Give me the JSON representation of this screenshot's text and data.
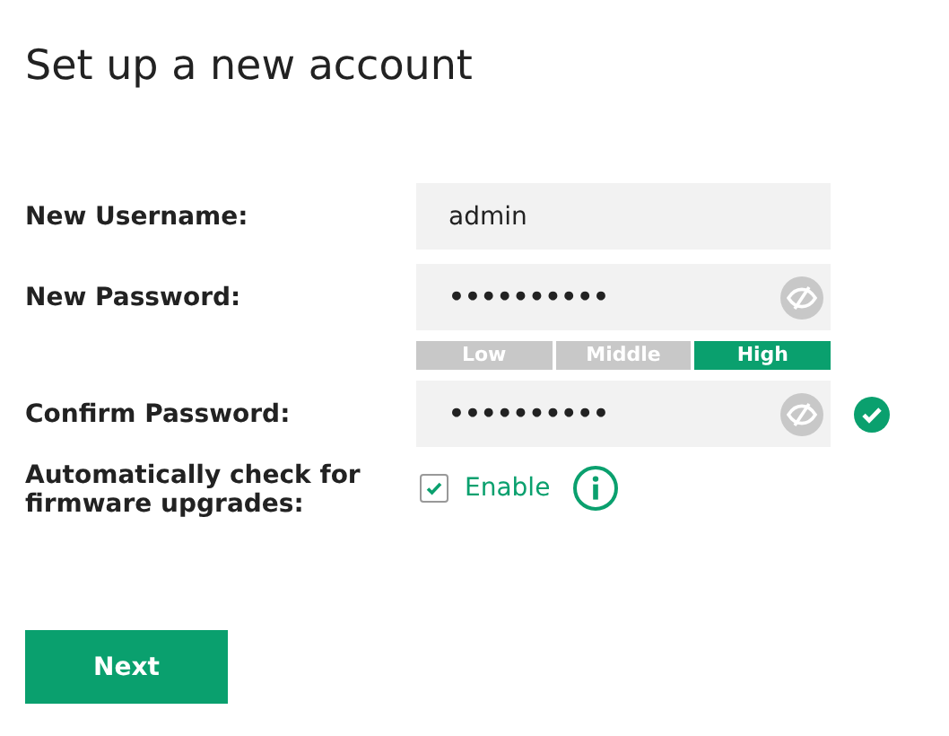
{
  "title": "Set up a new account",
  "fields": [
    {
      "label": "New Username:",
      "value": "admin",
      "kind": "text"
    },
    {
      "label": "New Password:",
      "value": "••••••••••",
      "kind": "password"
    },
    {
      "label": "Confirm Password:",
      "value": "••••••••••",
      "kind": "password",
      "valid": true
    }
  ],
  "strength": [
    {
      "label": "Low",
      "selected": false
    },
    {
      "label": "Middle",
      "selected": false
    },
    {
      "label": "High",
      "selected": true
    }
  ],
  "firmware": {
    "label": "Automatically check for firmware upgrades:",
    "option": "Enable",
    "checked": true
  },
  "button": "Next"
}
